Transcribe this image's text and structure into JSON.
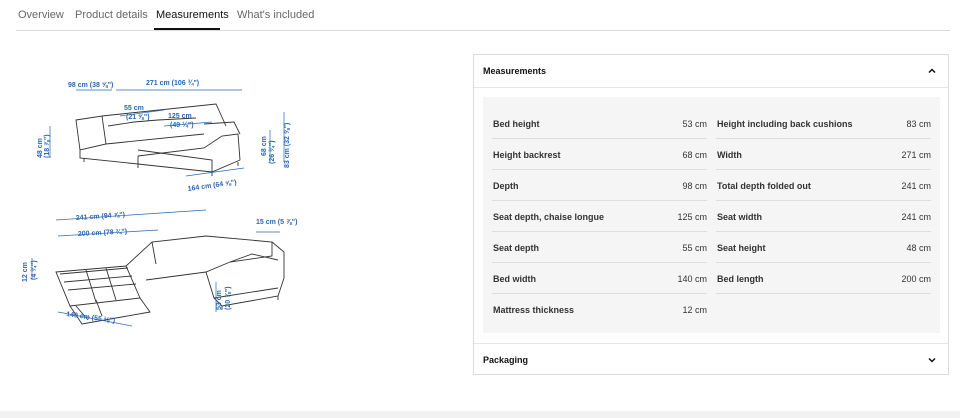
{
  "tabs": [
    {
      "label": "Overview"
    },
    {
      "label": "Product details"
    },
    {
      "label": "Measurements"
    },
    {
      "label": "What's included"
    }
  ],
  "active_tab": "Measurements",
  "diagram": {
    "top": {
      "width_arm": "98 cm (38 ⅝\")",
      "width_total": "271 cm (106 ¾\")",
      "seat_depth": "55 cm",
      "seat_depth_in": "(21 ⅝\")",
      "chaise_depth": "125 cm",
      "chaise_depth_in": "(49 ¼\")",
      "seat_height": "48 cm",
      "seat_height_in": "(18 ⅞\")",
      "backrest_height": "68 cm",
      "backrest_height_in": "(26 ¾\")",
      "total_height": "83 cm (32 ⅝\")",
      "chaise_length": "164 cm (64 ⅝\")"
    },
    "bed": {
      "total_depth": "241 cm (94 ⅞\")",
      "bed_length": "200 cm (78 ¾\")",
      "arm_width": "15 cm (5 ⅞\")",
      "mattress": "12 cm",
      "mattress_in": "(4 ¾\")",
      "bed_height": "53 cm",
      "bed_height_in": "(20 ⅞\")",
      "bed_width": "140 cm (55 ⅛\")"
    }
  },
  "measurements": {
    "title": "Measurements",
    "left": [
      {
        "label": "Bed height",
        "value": "53 cm"
      },
      {
        "label": "Height backrest",
        "value": "68 cm"
      },
      {
        "label": "Depth",
        "value": "98 cm"
      },
      {
        "label": "Seat depth, chaise longue",
        "value": "125 cm"
      },
      {
        "label": "Seat depth",
        "value": "55 cm"
      },
      {
        "label": "Bed width",
        "value": "140 cm"
      },
      {
        "label": "Mattress thickness",
        "value": "12 cm"
      }
    ],
    "right": [
      {
        "label": "Height including back cushions",
        "value": "83 cm"
      },
      {
        "label": "Width",
        "value": "271 cm"
      },
      {
        "label": "Total depth folded out",
        "value": "241 cm"
      },
      {
        "label": "Seat width",
        "value": "241 cm"
      },
      {
        "label": "Seat height",
        "value": "48 cm"
      },
      {
        "label": "Bed length",
        "value": "200 cm"
      }
    ]
  },
  "packaging": {
    "title": "Packaging"
  },
  "icons": {
    "expanded": "chevron-up-icon",
    "collapsed": "chevron-down-icon"
  },
  "colors": {
    "dimension_blue": "#2a66b4",
    "divider": "#dcdcdc",
    "panel_bg": "#f5f5f5"
  }
}
